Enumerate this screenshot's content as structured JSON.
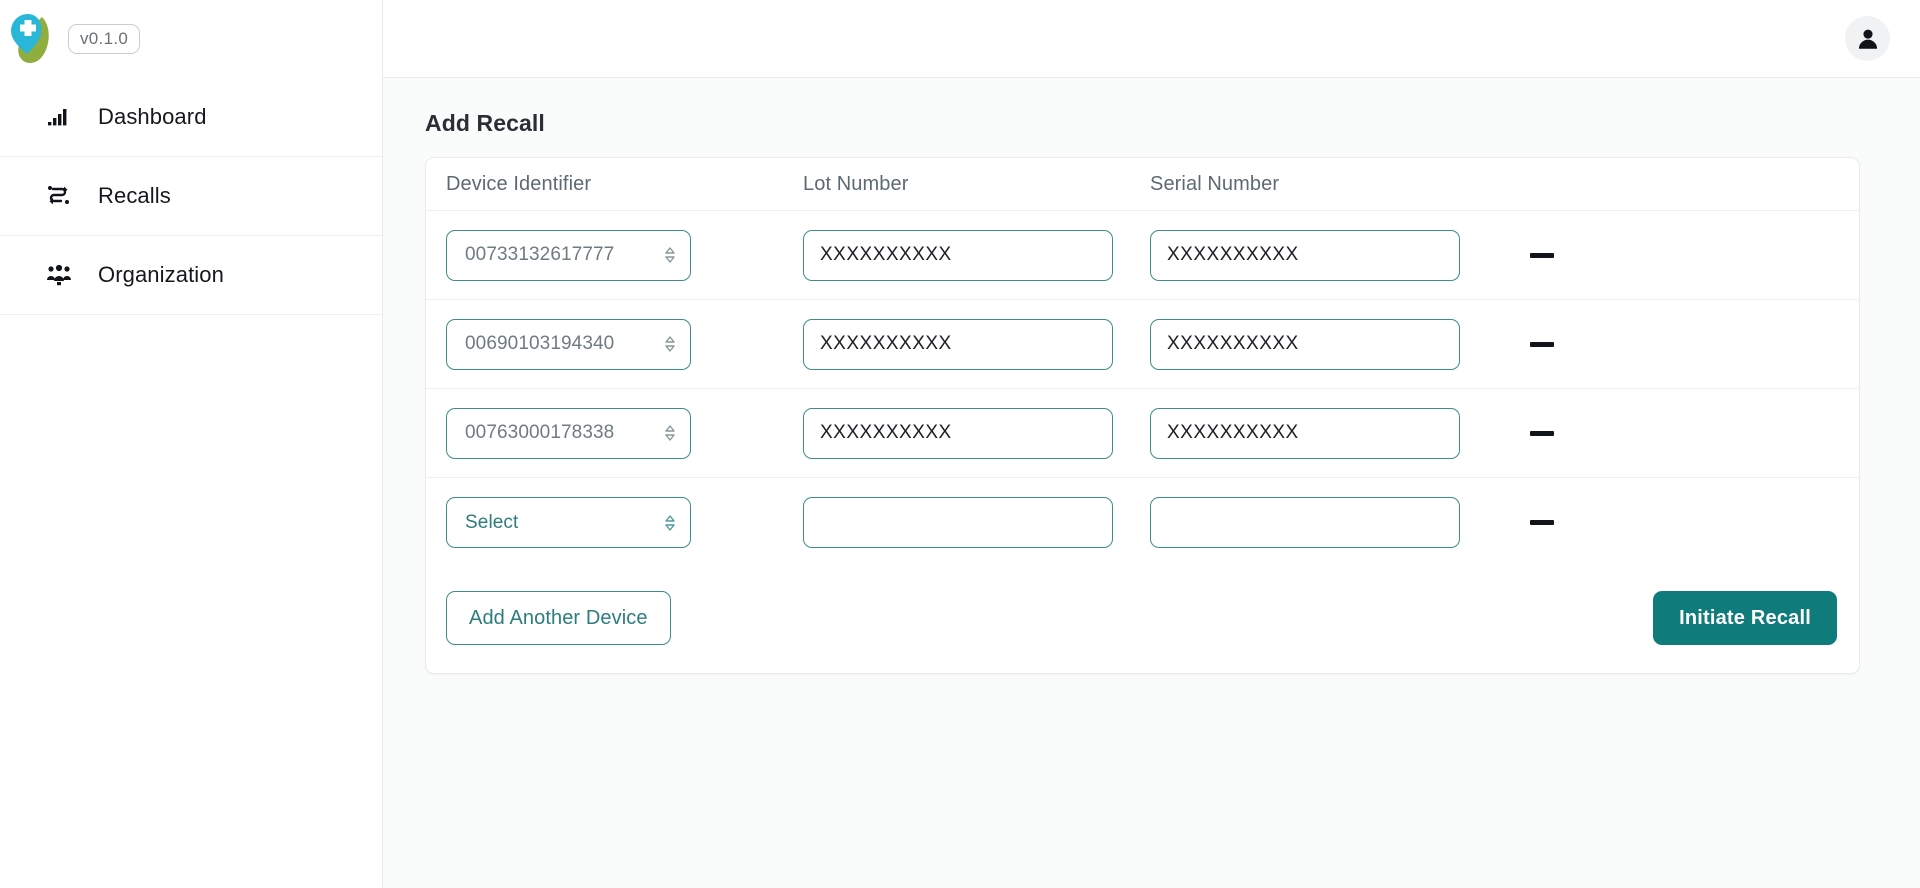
{
  "sidebar": {
    "logo_name": "map-pin-medical-logo",
    "version": "v0.1.0",
    "items": [
      {
        "label": "Dashboard",
        "icon": "bar-chart-icon"
      },
      {
        "label": "Recalls",
        "icon": "recall-arrows-icon"
      },
      {
        "label": "Organization",
        "icon": "people-group-icon"
      }
    ]
  },
  "topbar": {
    "avatar_icon": "user-avatar-icon"
  },
  "main": {
    "page_title": "Add Recall",
    "table": {
      "columns": [
        "Device Identifier",
        "Lot Number",
        "Serial Number"
      ],
      "select_placeholder": "Select",
      "rows": [
        {
          "device": "00733132617777",
          "lot": "XXXXXXXXXX",
          "serial": "XXXXXXXXXX"
        },
        {
          "device": "00690103194340",
          "lot": "XXXXXXXXXX",
          "serial": "XXXXXXXXXX"
        },
        {
          "device": "00763000178338",
          "lot": "XXXXXXXXXX",
          "serial": "XXXXXXXXXX"
        },
        {
          "device": "Select",
          "lot": "",
          "serial": ""
        }
      ]
    },
    "footer": {
      "add_device_label": "Add Another Device",
      "initiate_recall_label": "Initiate Recall"
    }
  },
  "colors": {
    "teal_primary": "#107b7b",
    "teal_border": "#3f8c8c",
    "logo_cyan": "#29b6d8",
    "logo_green": "#8fae3f"
  }
}
